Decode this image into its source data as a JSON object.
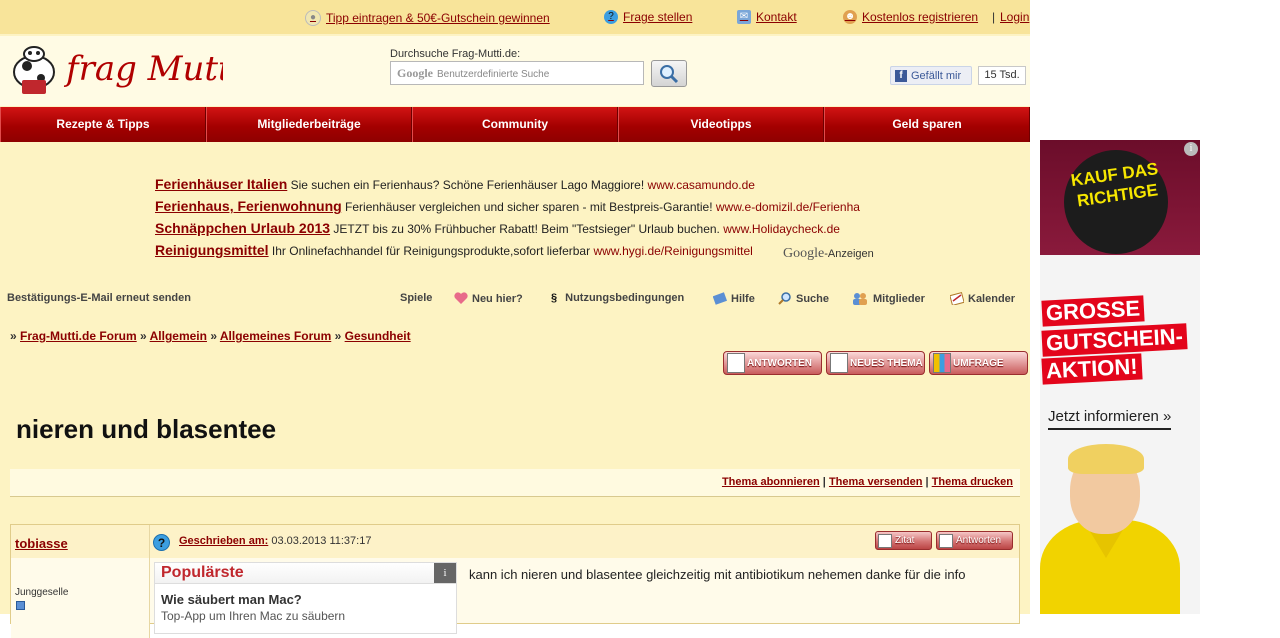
{
  "topbar": {
    "tip": "Tipp eintragen & 50€-Gutschein gewinnen",
    "question": "Frage stellen",
    "contact": "Kontakt",
    "register": "Kostenlos registrieren",
    "separator": "|",
    "login": "Login"
  },
  "header": {
    "logo_text": "frag Mutti",
    "search_label": "Durchsuche Frag-Mutti.de:",
    "search_brand": "Google",
    "search_placeholder": "Benutzerdefinierte Suche",
    "fb_like": "Gefällt mir",
    "fb_count": "15 Tsd."
  },
  "nav": [
    "Rezepte & Tipps",
    "Mitgliederbeiträge",
    "Community",
    "Videotipps",
    "Geld sparen"
  ],
  "ads": [
    {
      "title": "Ferienhäuser Italien",
      "text": "Sie suchen ein Ferienhaus? Schöne Ferienhäuser Lago Maggiore!",
      "url": "www.casamundo.de"
    },
    {
      "title": "Ferienhaus, Ferienwohnung",
      "text": "Ferienhäuser vergleichen und sicher sparen - mit Bestpreis-Garantie!",
      "url": "www.e-domizil.de/Ferienha"
    },
    {
      "title": "Schnäppchen Urlaub 2013",
      "text": "JETZT bis zu 30% Frühbucher Rabatt! Beim \"Testsieger\" Urlaub buchen.",
      "url": "www.Holidaycheck.de"
    },
    {
      "title": "Reinigungsmittel",
      "text": "Ihr Onlinefachhandel für Reinigungsprodukte,sofort lieferbar",
      "url": "www.hygi.de/Reinigungsmittel"
    }
  ],
  "google_ads": {
    "brand": "Google",
    "label": "-Anzeigen"
  },
  "toolbar": {
    "confirm": "Bestätigungs-E-Mail erneut senden",
    "games": "Spiele",
    "new": "Neu hier?",
    "terms": "Nutzungsbedingungen",
    "terms_symbol": "§",
    "help": "Hilfe",
    "search": "Suche",
    "members": "Mitglieder",
    "calendar": "Kalender"
  },
  "breadcrumb": {
    "sep": "»",
    "items": [
      "Frag-Mutti.de Forum",
      "Allgemein",
      "Allgemeines Forum",
      "Gesundheit"
    ]
  },
  "actions": {
    "reply": "ANTWORTEN",
    "new_topic": "NEUES THEMA",
    "poll": "UMFRAGE"
  },
  "thread": {
    "title": "nieren und blasentee",
    "subscribe": "Thema abonnieren",
    "send": "Thema versenden",
    "print": "Thema drucken",
    "sep": "|"
  },
  "post": {
    "author": "tobiasse",
    "rank": "Junggeselle",
    "written_label": "Geschrieben am:",
    "date": "03.03.2013 11:37:17",
    "quote": "Zitat",
    "reply": "Antworten",
    "text": "kann ich nieren und blasentee gleichzeitig mit antibiotikum nehemen danke für die info"
  },
  "popular": {
    "heading": "Populärste",
    "info": "i",
    "question": "Wie säubert man Mac?",
    "snippet": "Top-App um Ihren Mac zu säubern"
  },
  "sidead": {
    "circle": "KAUF DAS RICHTIGE",
    "line1": "GROSSE",
    "line2": "GUTSCHEIN-",
    "line3": "AKTION!",
    "cta": "Jetzt informieren »",
    "info": "i"
  },
  "colors": {
    "brand_red": "#b00000",
    "link": "#8b0000",
    "page_bg": "#fdf3c3",
    "topbar_bg": "#f8e49a"
  }
}
